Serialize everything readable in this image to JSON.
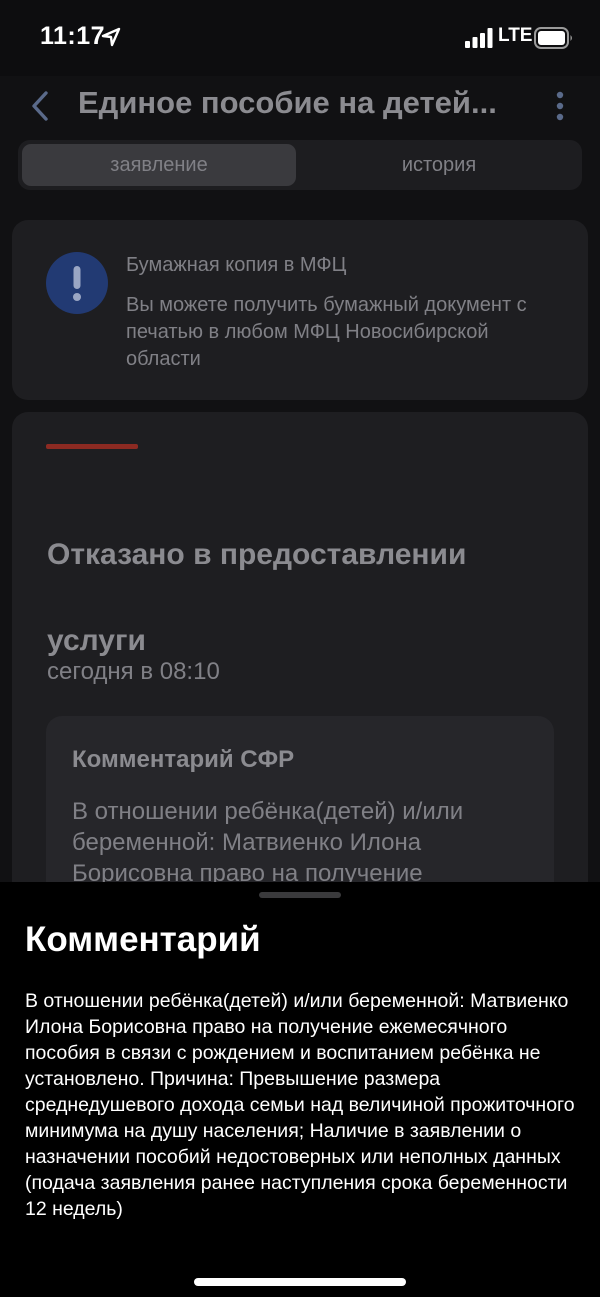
{
  "status_bar": {
    "time": "11:17",
    "network": "LTE"
  },
  "header": {
    "title": "Единое пособие на детей..."
  },
  "tabs": [
    {
      "label": "заявление",
      "active": true
    },
    {
      "label": "история",
      "active": false
    }
  ],
  "info_card": {
    "icon": "exclamation-icon",
    "title": "Бумажная копия в МФЦ",
    "text": "Вы можете получить бумажный документ с печатью в любом МФЦ Новосибирской области"
  },
  "status_card": {
    "accent_color": "#8c2a22",
    "title": "Отказано в предоставлении услуги",
    "date": "сегодня в 08:10",
    "comment_title": "Комментарий СФР",
    "comment_text": "В отношении ребёнка(детей) и/или беременной: Матвиенко Илона Борисовна право на получение"
  },
  "sheet": {
    "title": "Комментарий",
    "text": "В отношении ребёнка(детей) и/или беременной: Матвиенко Илона Борисовна право на получение ежемесячного пособия в связи с рождением и воспитанием ребёнка не установлено. Причина: Превышение размера среднедушевого дохода семьи над величиной прожиточного минимума на душу населения; Наличие в заявлении о назначении пособий недостоверных или неполных данных (подача заявления ранее наступления срока беременности 12 недель)"
  },
  "colors": {
    "alert_icon_bg": "#223a73",
    "alert_mark": "#9aa6c4"
  }
}
